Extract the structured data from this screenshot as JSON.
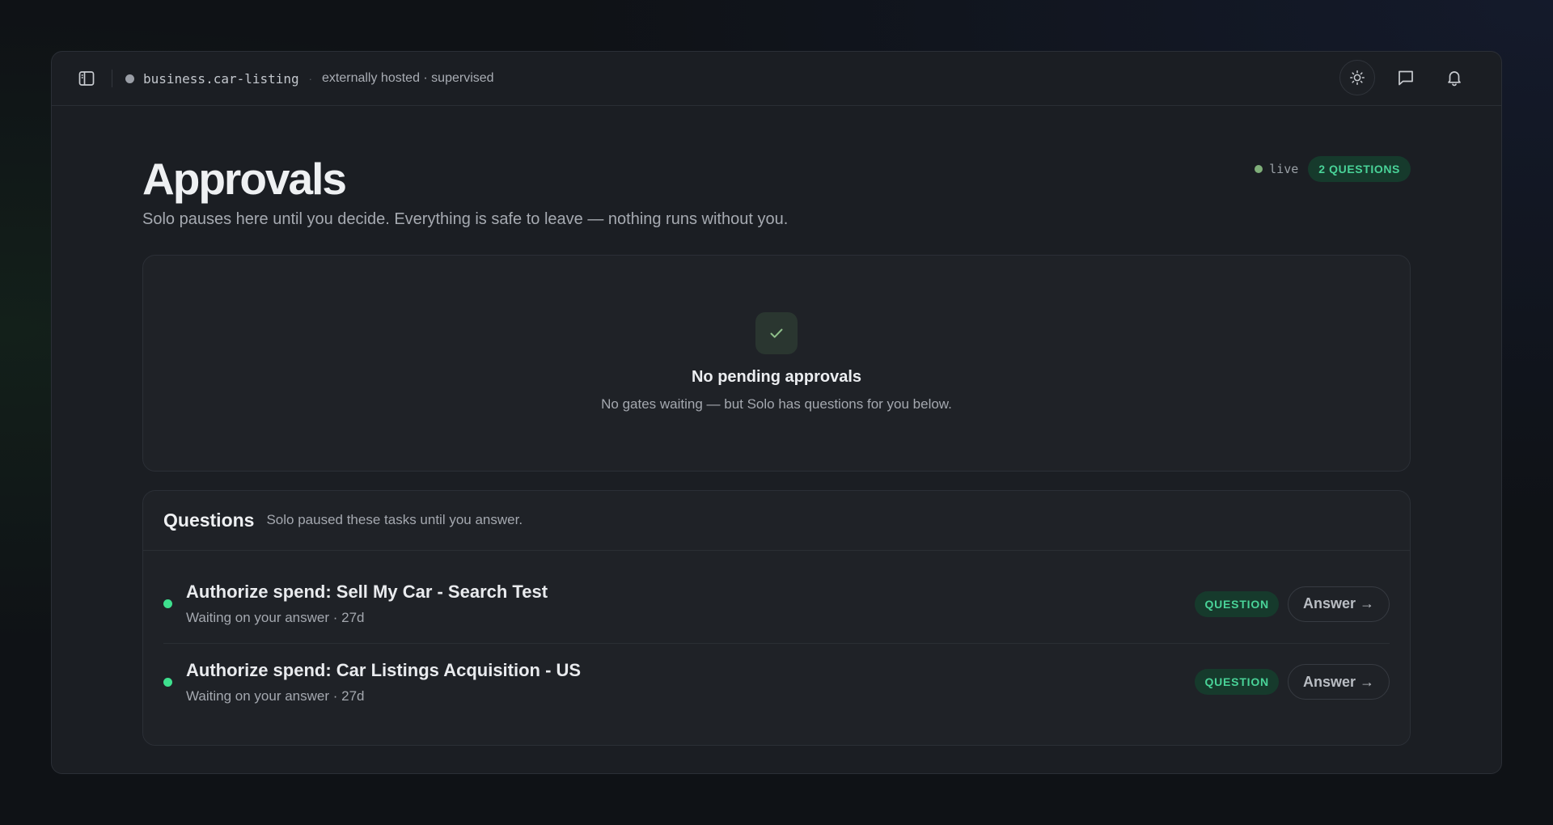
{
  "topbar": {
    "workspace": "business.car-listing",
    "separator": "·",
    "hosting": "externally hosted · supervised",
    "icons": [
      "sidebar-toggle-icon",
      "sun-icon",
      "chat-icon",
      "bell-icon"
    ]
  },
  "header": {
    "title": "Approvals",
    "subtitle": "Solo pauses here until you decide. Everything is safe to leave — nothing runs without you.",
    "live_label": "live",
    "questions_badge": "2 QUESTIONS"
  },
  "empty_state": {
    "icon": "check-icon",
    "title": "No pending approvals",
    "description": "No gates waiting — but Solo has questions for you below."
  },
  "questions": {
    "title": "Questions",
    "subtitle": "Solo paused these tasks until you answer.",
    "items": [
      {
        "title": "Authorize spend: Sell My Car - Search Test",
        "meta": "Waiting on your answer · 27d",
        "badge": "QUESTION",
        "action": "Answer →"
      },
      {
        "title": "Authorize spend: Car Listings Acquisition - US",
        "meta": "Waiting on your answer · 27d",
        "badge": "QUESTION",
        "action": "Answer →"
      }
    ]
  },
  "colors": {
    "accent_green": "#3ee08e",
    "badge_bg": "#163a2c",
    "live_dot": "#7fae79",
    "background": "#0f1216",
    "panel": "#1b1e23"
  }
}
